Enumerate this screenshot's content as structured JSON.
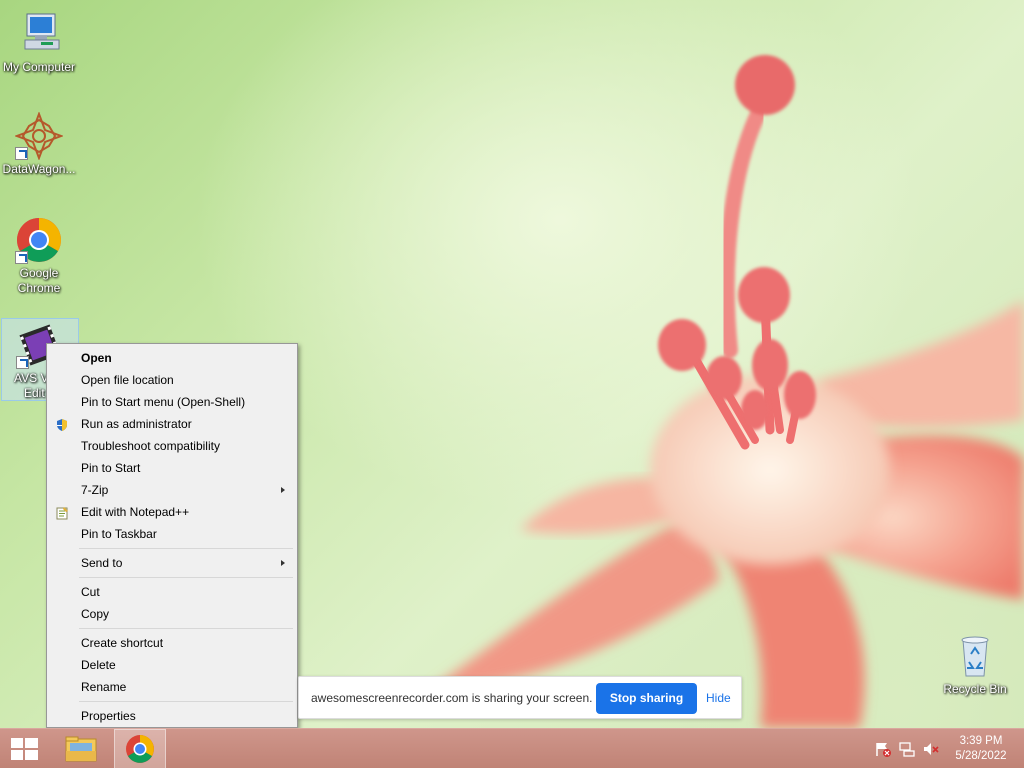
{
  "desktop": {
    "icons": [
      {
        "label": "My Computer",
        "icon": "computer-icon"
      },
      {
        "label": "DataWagon...",
        "icon": "datawagon-icon"
      },
      {
        "label": "Google Chrome",
        "icon": "chrome-icon"
      },
      {
        "label": "AVS Video Editor",
        "label_visible": "AVS Vi",
        "label_visible_2": "Edit",
        "icon": "avs-video-editor-icon"
      },
      {
        "label": "Recycle Bin",
        "icon": "recycle-bin-icon"
      }
    ]
  },
  "context_menu": {
    "items": [
      {
        "label": "Open",
        "bold": true
      },
      {
        "label": "Open file location"
      },
      {
        "label": "Pin to Start menu (Open-Shell)"
      },
      {
        "label": "Run as administrator",
        "icon": "uac-shield-icon"
      },
      {
        "label": "Troubleshoot compatibility"
      },
      {
        "label": "Pin to Start"
      },
      {
        "label": "7-Zip",
        "submenu": true
      },
      {
        "label": "Edit with Notepad++",
        "icon": "notepad-plus-plus-icon"
      },
      {
        "label": "Pin to Taskbar"
      },
      {
        "label": "Send to",
        "submenu": true
      },
      {
        "label": "Cut"
      },
      {
        "label": "Copy"
      },
      {
        "label": "Create shortcut"
      },
      {
        "label": "Delete"
      },
      {
        "label": "Rename"
      },
      {
        "label": "Properties"
      }
    ]
  },
  "share_bar": {
    "message": "awesomescreenrecorder.com is sharing your screen.",
    "stop_label": "Stop sharing",
    "hide_label": "Hide",
    "accent": "#1a73e8"
  },
  "taskbar": {
    "pinned": [
      {
        "name": "file-explorer-icon"
      },
      {
        "name": "chrome-icon",
        "active": true
      }
    ],
    "tray": [
      "action-center-flag-icon",
      "network-icon",
      "volume-muted-icon"
    ],
    "clock": {
      "time": "3:39 PM",
      "date": "5/28/2022"
    },
    "color": "#c58a80"
  }
}
